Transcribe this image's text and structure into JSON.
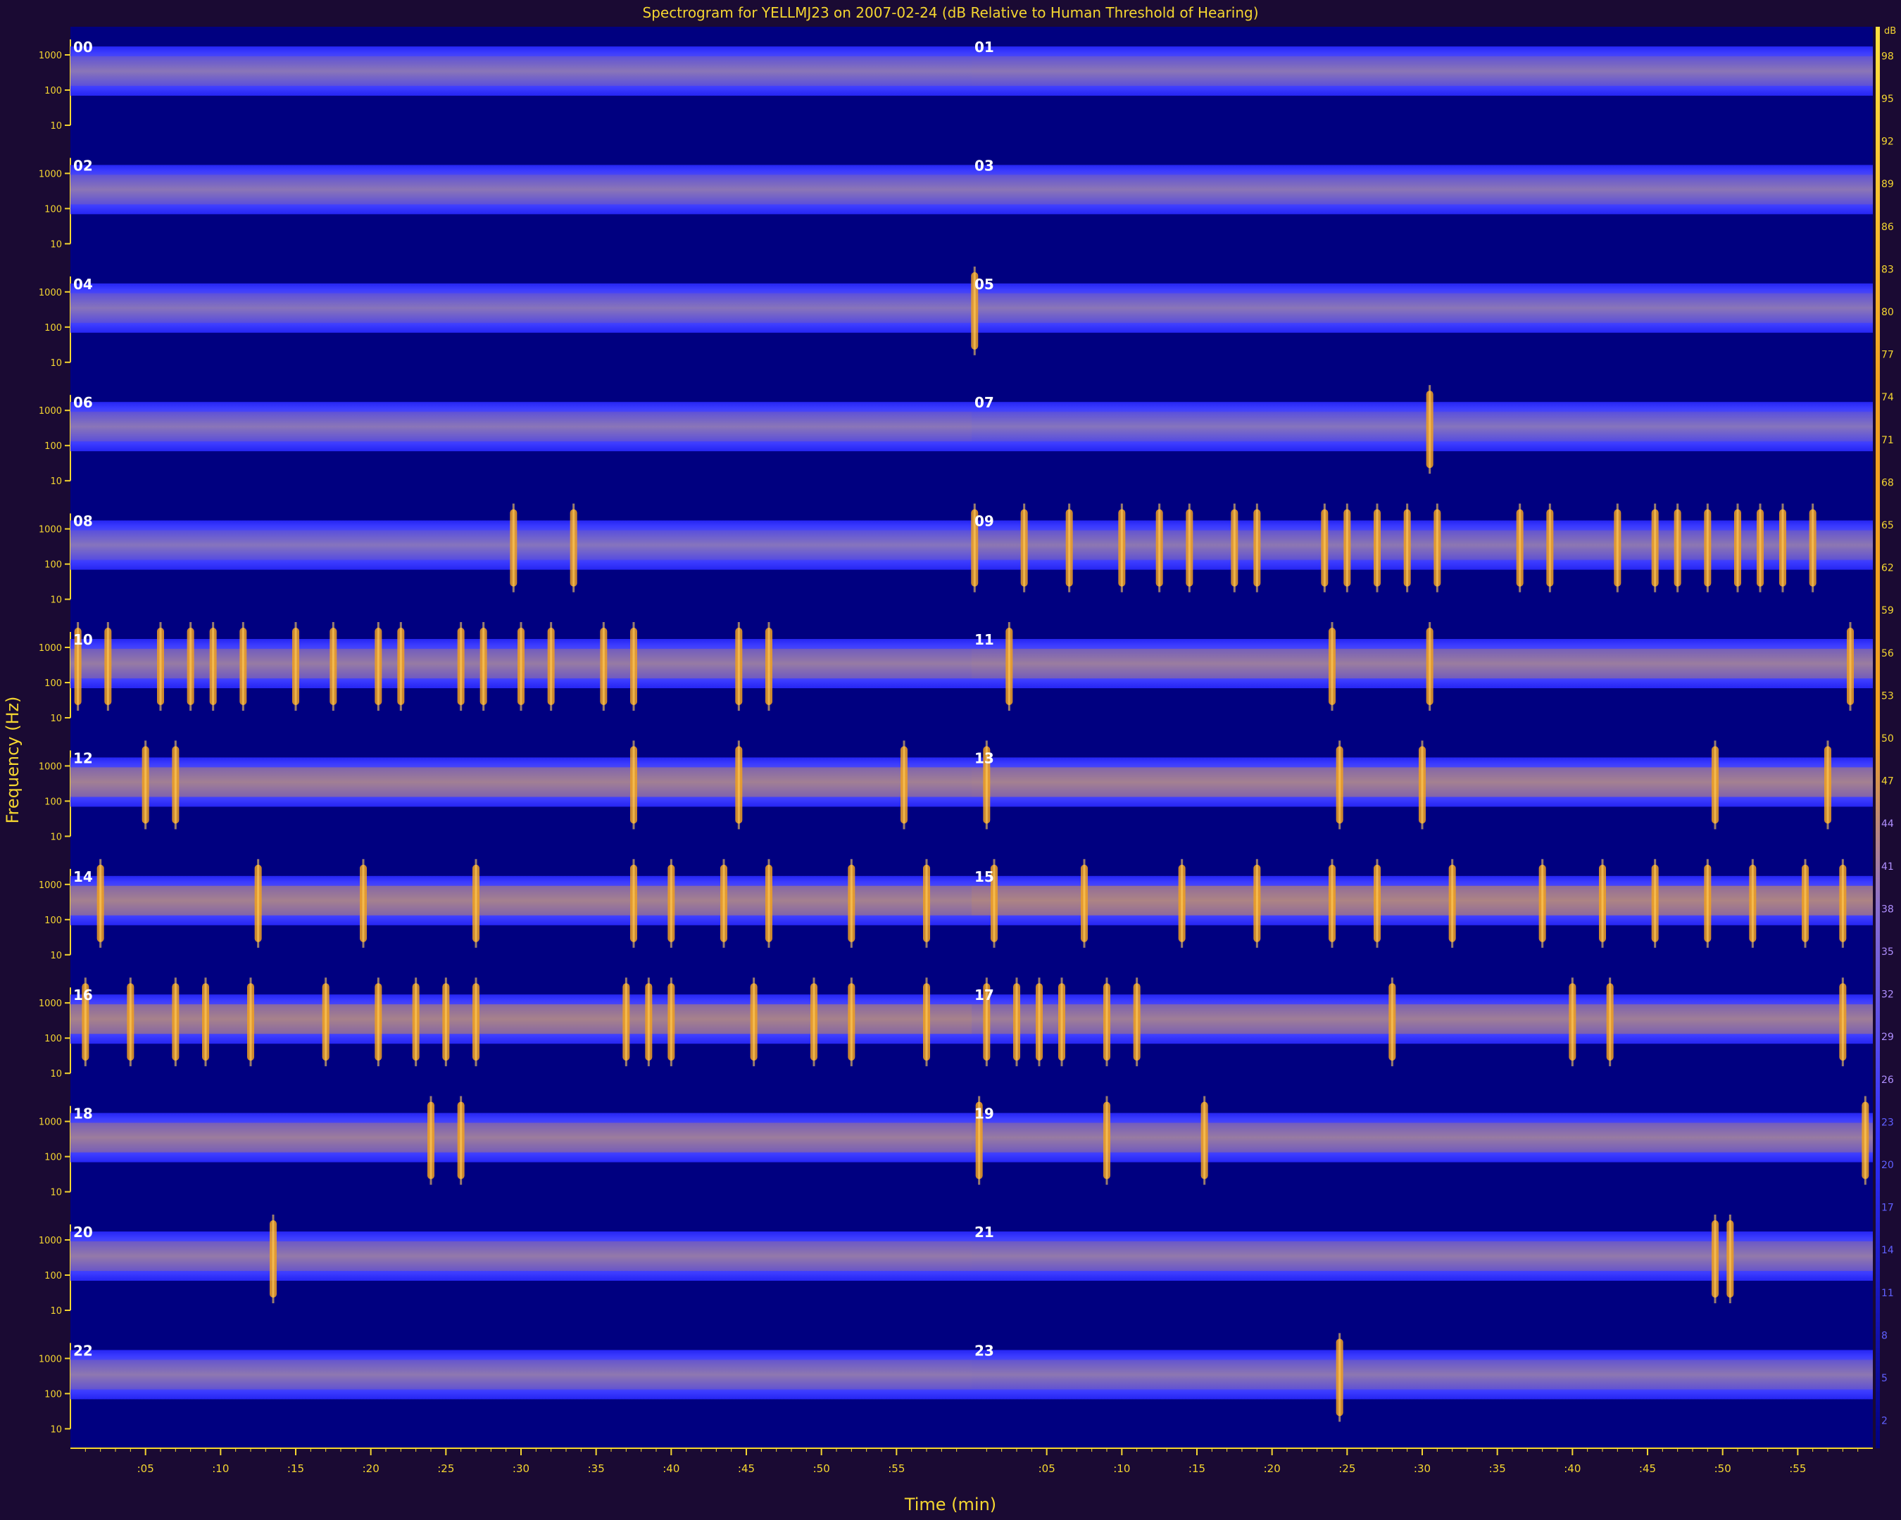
{
  "chart_data": {
    "type": "heatmap",
    "title": "Spectrogram for YELLMJ23 on 2007-02-24 (dB Relative to Human Threshold of Hearing)",
    "ylabel": "Frequency (Hz)",
    "xlabel": "Time (min)",
    "y_tick_labels": [
      "1000",
      "100",
      "10"
    ],
    "x_tick_labels": [
      ":05",
      ":10",
      ":15",
      ":20",
      ":25",
      ":30",
      ":35",
      ":40",
      ":45",
      ":50",
      ":55"
    ],
    "hour_labels": [
      "00",
      "01",
      "02",
      "03",
      "04",
      "05",
      "06",
      "07",
      "08",
      "09",
      "10",
      "11",
      "12",
      "13",
      "14",
      "15",
      "16",
      "17",
      "18",
      "19",
      "20",
      "21",
      "22",
      "23"
    ],
    "colorbar_ticks": [
      98,
      95,
      92,
      89,
      86,
      83,
      80,
      77,
      74,
      71,
      68,
      65,
      62,
      59,
      56,
      53,
      50,
      47,
      44,
      41,
      38,
      35,
      32,
      29,
      26,
      23,
      20,
      17,
      14,
      11,
      8,
      5,
      2
    ],
    "colorbar_unit": "dB",
    "colors": {
      "background": "#1a0a33",
      "low": "#000080",
      "mid": "#2a2aff",
      "high": "#f0a020",
      "axis": "#f5d630",
      "label": "#ffffff"
    },
    "hour_intensity": [
      0.25,
      0.28,
      0.28,
      0.27,
      0.22,
      0.25,
      0.25,
      0.2,
      0.2,
      0.3,
      0.45,
      0.5,
      0.62,
      0.65,
      0.68,
      0.78,
      0.7,
      0.58,
      0.52,
      0.48,
      0.4,
      0.38,
      0.32,
      0.3
    ],
    "events": {
      "05": [
        0.2
      ],
      "07": [
        30.5
      ],
      "08": [
        29.5,
        33.5
      ],
      "09": [
        0.2,
        3.5,
        6.5,
        10,
        12.5,
        14.5,
        17.5,
        19,
        23.5,
        25,
        27,
        29,
        31,
        36.5,
        38.5,
        43,
        45.5,
        47,
        49,
        51,
        52.5,
        54,
        56
      ],
      "10": [
        0.5,
        2.5,
        6,
        8,
        9.5,
        11.5,
        15,
        17.5,
        20.5,
        22,
        26,
        27.5,
        30,
        32,
        35.5,
        37.5,
        44.5,
        46.5
      ],
      "11": [
        2.5,
        24,
        30.5,
        58.5
      ],
      "12": [
        5,
        7,
        37.5,
        44.5,
        55.5
      ],
      "13": [
        1,
        24.5,
        30,
        49.5,
        57
      ],
      "14": [
        2,
        12.5,
        19.5,
        27,
        37.5,
        40,
        43.5,
        46.5,
        52,
        57
      ],
      "15": [
        1.5,
        7.5,
        14,
        19,
        24,
        27,
        32,
        38,
        42,
        45.5,
        49,
        52,
        55.5,
        58
      ],
      "16": [
        1,
        4,
        7,
        9,
        12,
        17,
        20.5,
        23,
        25,
        27,
        37,
        38.5,
        40,
        45.5,
        49.5,
        52,
        57
      ],
      "17": [
        1,
        3,
        4.5,
        6,
        9,
        11,
        28,
        40,
        42.5,
        58
      ],
      "18": [
        24,
        26
      ],
      "19": [
        0.5,
        9,
        15.5,
        59.5
      ],
      "20": [
        13.5
      ],
      "21": [
        49.5,
        50.5
      ],
      "22": [],
      "23": [
        24.5
      ]
    }
  }
}
